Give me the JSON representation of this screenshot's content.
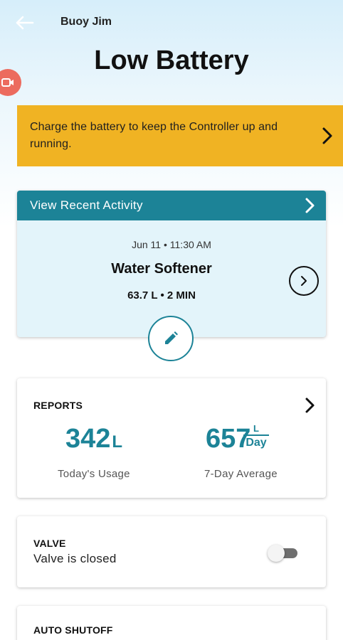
{
  "header": {
    "back_icon": "arrow-left-icon",
    "device_name": "Buoy Jim",
    "title": "Low Battery",
    "record_icon": "video-camera-icon",
    "record_color": "#ec6b5e"
  },
  "banner": {
    "text": "Charge the battery to keep the Controller up and running.",
    "color": "#f0b323",
    "chevron_icon": "chevron-right-icon"
  },
  "activity": {
    "header_label": "View Recent Activity",
    "header_color": "#1c8397",
    "time": "Jun 11 • 11:30 AM",
    "name": "Water Softener",
    "stat": "63.7 L • 2 MIN",
    "go_icon": "chevron-right-circle-icon",
    "edit_icon": "pencil-icon"
  },
  "reports": {
    "label": "REPORTS",
    "today_value": "342",
    "today_unit": "L",
    "today_label": "Today's Usage",
    "avg_value": "657",
    "avg_unit_top": "L",
    "avg_unit_bottom": "Day",
    "avg_label": "7-Day Average",
    "accent": "#1c8397"
  },
  "valve": {
    "label": "VALVE",
    "status": "Valve is closed",
    "toggle_on": false
  },
  "auto_shutoff": {
    "label": "AUTO SHUTOFF"
  }
}
